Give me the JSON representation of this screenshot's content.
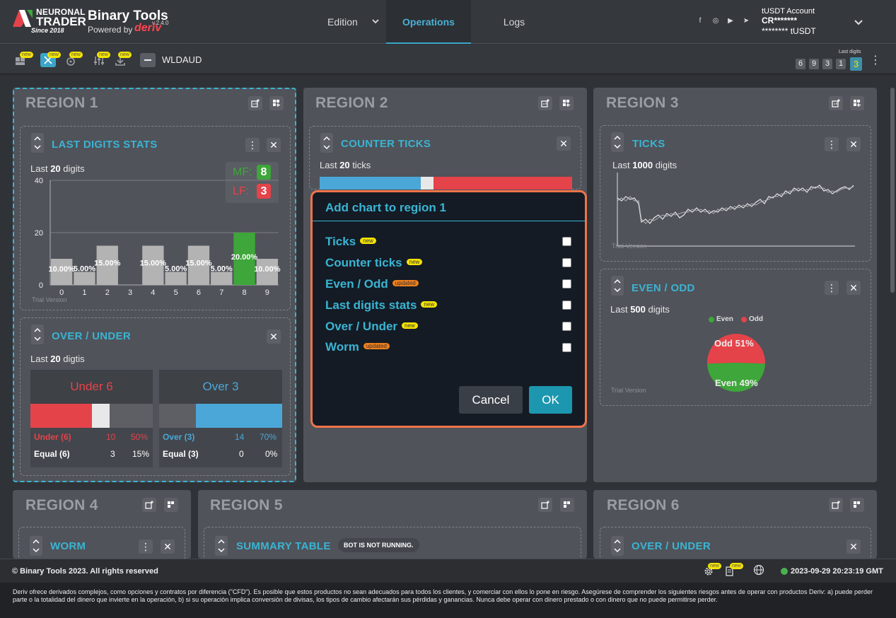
{
  "header": {
    "logo_line1": "NEURONAL",
    "logo_line2": "TRADER",
    "logo_since": "Since 2018",
    "app_title": "Binary Tools",
    "version": "v.2.4.0",
    "powered_by": "Powered by",
    "deriv": "deriv",
    "nav": {
      "edition": "Edition",
      "operations": "Operations",
      "logs": "Logs"
    },
    "account": {
      "name": "tUSDT Account",
      "id": "CR*******",
      "balance": "******** tUSDT"
    }
  },
  "toolbar": {
    "new_badge": "new",
    "asset": "WLDAUD",
    "last_digits_label": "Last digits",
    "last_digits": [
      "6",
      "9",
      "3",
      "1",
      "3"
    ]
  },
  "regions": {
    "r1": {
      "title": "REGION 1"
    },
    "r2": {
      "title": "REGION 2"
    },
    "r3": {
      "title": "REGION 3"
    },
    "r4": {
      "title": "REGION 4"
    },
    "r5": {
      "title": "REGION 5"
    },
    "r6": {
      "title": "REGION 6"
    }
  },
  "cards": {
    "last_digits": {
      "title": "LAST DIGITS STATS",
      "sub_pre": "Last ",
      "sub_num": "20",
      "sub_post": " digits",
      "mf_label": "MF:",
      "mf_value": "8",
      "lf_label": "LF:",
      "lf_value": "3",
      "trial": "Trial Version"
    },
    "over_under": {
      "title": "OVER / UNDER",
      "sub_pre": "Last ",
      "sub_num": "20",
      "sub_post": " digtis",
      "under_title": "Under 6",
      "over_title": "Over 3",
      "under_row": {
        "label": "Under (6)",
        "count": "10",
        "pct": "50%"
      },
      "under_eq": {
        "label": "Equal (6)",
        "count": "3",
        "pct": "15%"
      },
      "over_row": {
        "label": "Over (3)",
        "count": "14",
        "pct": "70%"
      },
      "over_eq": {
        "label": "Equal (3)",
        "count": "0",
        "pct": "0%"
      }
    },
    "counter_ticks": {
      "title": "COUNTER TICKS",
      "sub_pre": "Last ",
      "sub_num": "20",
      "sub_post": " ticks"
    },
    "ticks": {
      "title": "TICKS",
      "sub_pre": "Last ",
      "sub_num": "1000",
      "sub_post": " digits",
      "trial": "Trial Version"
    },
    "even_odd": {
      "title": "EVEN / ODD",
      "sub_pre": "Last ",
      "sub_num": "500",
      "sub_post": " digits",
      "legend_even": "Even",
      "legend_odd": "Odd",
      "odd_label": "Odd 51%",
      "even_label": "Even 49%",
      "trial": "Trial Version"
    },
    "worm": {
      "title": "WORM"
    },
    "summary": {
      "title": "SUMMARY TABLE",
      "badge": "BOT IS NOT RUNNING."
    },
    "over_under_r6": {
      "title": "OVER / UNDER"
    }
  },
  "chart_data": [
    {
      "type": "bar",
      "categories": [
        "0",
        "1",
        "2",
        "3",
        "4",
        "5",
        "6",
        "7",
        "8",
        "9"
      ],
      "values": [
        10,
        5,
        15,
        0,
        15,
        5,
        15,
        5,
        20,
        10
      ],
      "data_labels": [
        "10.00%",
        "5.00%",
        "15.00%",
        "",
        "15.00%",
        "5.00%",
        "15.00%",
        "5.00%",
        "20.00%",
        "10.00%"
      ],
      "y_ticks": [
        "0",
        "20",
        "40"
      ],
      "ylim": [
        0,
        40
      ],
      "highlight_index": 8,
      "bar_color": "#b3b3b3",
      "highlight_color": "#3ea63a"
    },
    {
      "type": "bar",
      "categories": [
        "Under 6 - below",
        "Under 6 - equal",
        "Under 6 - above"
      ],
      "values": [
        50,
        15,
        35
      ],
      "colors": [
        "#e5434a",
        "#e8e8e8",
        "#5d5f64"
      ]
    },
    {
      "type": "bar",
      "categories": [
        "Over 3 - below",
        "Over 3 - above"
      ],
      "values": [
        30,
        70
      ],
      "colors": [
        "#5d5f64",
        "#4ba7d8"
      ]
    },
    {
      "type": "pie",
      "categories": [
        "Odd",
        "Even"
      ],
      "values": [
        51,
        49
      ],
      "colors": [
        "#e5434a",
        "#3ea63a"
      ]
    },
    {
      "type": "bar",
      "categories": [
        "blue",
        "white",
        "red"
      ],
      "values": [
        40,
        5,
        55
      ],
      "colors": [
        "#4ba7d8",
        "#e8e8e8",
        "#e5434a"
      ]
    }
  ],
  "modal": {
    "title": "Add chart to region 1",
    "options": [
      {
        "label": "Ticks",
        "badge": "new",
        "kind": "new"
      },
      {
        "label": "Counter ticks",
        "badge": "new",
        "kind": "new"
      },
      {
        "label": "Even / Odd",
        "badge": "updated",
        "kind": "upd"
      },
      {
        "label": "Last digits stats",
        "badge": "new",
        "kind": "new"
      },
      {
        "label": "Over / Under",
        "badge": "new",
        "kind": "new"
      },
      {
        "label": "Worm",
        "badge": "updated",
        "kind": "upd"
      }
    ],
    "cancel": "Cancel",
    "ok": "OK"
  },
  "footer": {
    "copyright": "© Binary Tools 2023. All rights reserved",
    "clock": "2023-09-29 20:23:19 GMT",
    "disclaimer": "Deriv ofrece derivados complejos, como opciones y contratos por diferencia (\"CFD\"). Es posible que estos productos no sean adecuados para todos los clientes, y comerciar con ellos lo pone en riesgo. Asegúrese de comprender los siguientes riesgos antes de operar con productos Deriv: a) puede perder parte o la totalidad del dinero que invierte en la operación, b) si su operación implica conversión de divisas, los tipos de cambio afectarán sus pérdidas y ganancias. Nunca debe operar con dinero prestado o con dinero que no puede permitirse perder."
  }
}
